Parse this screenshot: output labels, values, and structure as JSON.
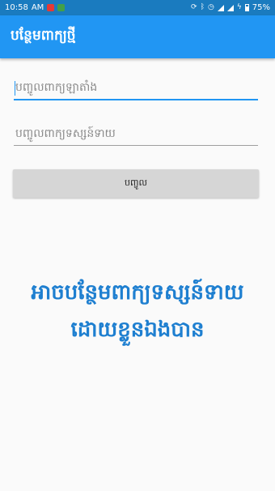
{
  "status_bar": {
    "time": "10:58",
    "am_pm": "AM",
    "battery": "75%"
  },
  "app_bar": {
    "title": "បន្ថែមពាក្យថ្មី"
  },
  "form": {
    "word_placeholder": "បញ្ចូលពាក្យឡាតាំង",
    "meaning_placeholder": "បញ្ចូលពាក្យទស្សន៍ទាយ",
    "submit_label": "បញ្ចូល"
  },
  "message": {
    "line1": "អាចបន្ថែមពាក្យទស្សន៍ទាយ",
    "line2": "ដោយខ្លួនឯងបាន"
  },
  "colors": {
    "status_bar": "#1a7bbf",
    "app_bar": "#2196f3",
    "accent": "#2196f3",
    "message_text": "#1e7fd0",
    "button_bg": "#d6d6d6"
  }
}
